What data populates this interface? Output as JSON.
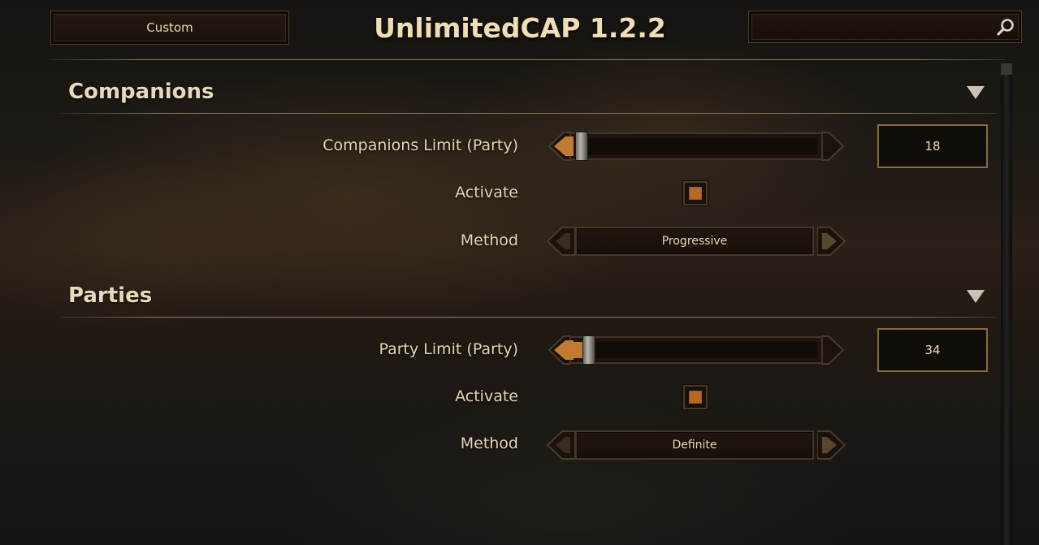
{
  "header": {
    "preset_label": "Custom",
    "title": "UnlimitedCAP 1.2.2",
    "search": {
      "value": "",
      "placeholder": ""
    }
  },
  "sections": [
    {
      "title": "Companions",
      "slider": {
        "label": "Companions Limit (Party)",
        "value": "18",
        "fraction": 0.02
      },
      "activate": {
        "label": "Activate",
        "checked": true
      },
      "method": {
        "label": "Method",
        "value": "Progressive"
      }
    },
    {
      "title": "Parties",
      "slider": {
        "label": "Party Limit (Party)",
        "value": "34",
        "fraction": 0.05
      },
      "activate": {
        "label": "Activate",
        "checked": true
      },
      "method": {
        "label": "Method",
        "value": "Definite"
      }
    }
  ],
  "colors": {
    "accent_orange": "#b86a25",
    "text_cream": "#e8d7b6",
    "frame_bronze": "#8a6a3f"
  },
  "icons": {
    "search": "search-icon",
    "collapse": "triangle-down-icon",
    "prev": "arrow-left-icon",
    "next": "arrow-right-icon"
  }
}
